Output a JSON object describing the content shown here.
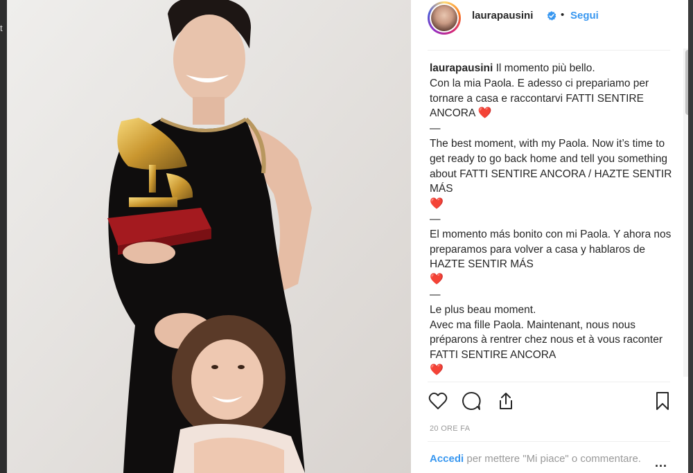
{
  "backdrop": {
    "edge_glyph": "t"
  },
  "post": {
    "username": "laurapausini",
    "verified_icon": "verified-badge-icon",
    "separator": "•",
    "follow_label": "Segui",
    "caption": {
      "username": "laurapausini",
      "lines": [
        "Il momento più bello.",
        "Con la mia Paola. E adesso ci prepariamo per tornare a casa e raccontarvi FATTI SENTIRE ANCORA",
        "—",
        "The best moment, with my Paola. Now it’s time to get ready to go back home and tell you something about FATTI SENTIRE ANCORA / HAZTE SENTIR MÁS",
        "—",
        "El momento más bonito con mi Paola. Y ahora nos preparamos para volver a casa y hablaros de HAZTE SENTIR MÁS",
        "—",
        "Le plus beau moment.",
        "Avec ma fille Paola. Maintenant, nous nous préparons à rentrer chez nous et à vous raconter FATTI SENTIRE ANCORA"
      ],
      "heart": "❤️"
    },
    "timestamp": "20 ORE FA",
    "login": {
      "link": "Accedi",
      "text": "per mettere \"Mi piace\" o commentare."
    },
    "more_label": "..."
  },
  "colors": {
    "link": "#3897f0",
    "text": "#262626",
    "muted": "#999999",
    "heart": "#e2242d"
  }
}
